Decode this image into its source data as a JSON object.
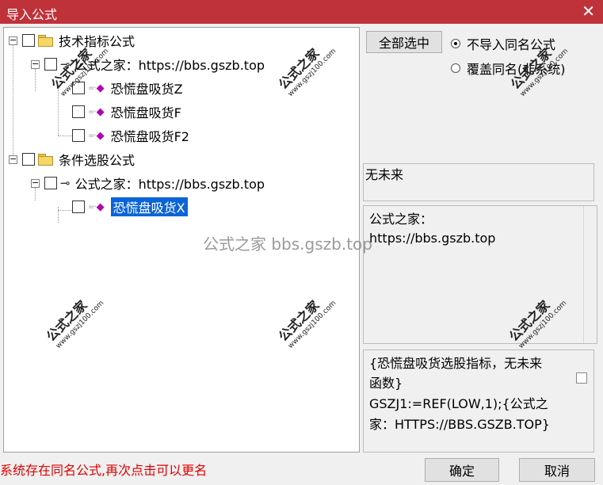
{
  "window": {
    "title": "导入公式",
    "close_glyph": "✕"
  },
  "tree": {
    "expand_glyph": "−",
    "nodes": [
      {
        "label": "技术指标公式",
        "type": "folder"
      },
      {
        "label": "公式之家：https://bbs.gszb.top",
        "type": "author"
      },
      {
        "label": "恐慌盘吸货Z",
        "type": "formula"
      },
      {
        "label": "恐慌盘吸货F",
        "type": "formula"
      },
      {
        "label": "恐慌盘吸货F2",
        "type": "formula"
      },
      {
        "label": "条件选股公式",
        "type": "folder"
      },
      {
        "label": "公式之家：https://bbs.gszb.top",
        "type": "author"
      },
      {
        "label": "恐慌盘吸货X",
        "type": "formula",
        "selected": true
      }
    ]
  },
  "controls": {
    "select_all": "全部选中",
    "radio_no_import": "不导入同名公式",
    "radio_overwrite": "覆盖同名(非系统)"
  },
  "info": {
    "future": "无未来",
    "author_line1": "公式之家：",
    "author_line2": "https://bbs.gszb.top",
    "desc_line1": "{恐慌盘吸货选股指标，无未来",
    "desc_line2": "函数}",
    "desc_line3": "GSZJ1:=REF(LOW,1);{公式之",
    "desc_line4": "家：HTTPS://BBS.GSZB.TOP}"
  },
  "status": "系统存在同名公式,再次点击可以更名",
  "buttons": {
    "ok": "确定",
    "cancel": "取消"
  },
  "watermark": {
    "text": "公式之家",
    "url": "www.gszj100.com",
    "center": "公式之家 bbs.gszb.top"
  },
  "icons": {
    "key": "⊸",
    "gem": "◆",
    "dots": "=·"
  }
}
